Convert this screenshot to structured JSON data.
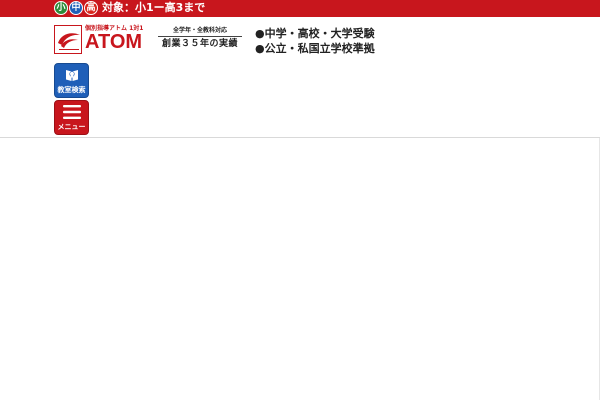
{
  "topbar": {
    "badges": [
      {
        "label": "小",
        "color": "#2e8b3a"
      },
      {
        "label": "中",
        "color": "#1f5fb8"
      },
      {
        "label": "高",
        "color": "#d9261c"
      }
    ],
    "target_text": "対象：小1ー高3まで",
    "background": "#c8161d"
  },
  "logo": {
    "tagline": "個別指導アトム 1対1",
    "name": "ATOM",
    "mark_icon": "red-swoosh-logo-icon",
    "brand_color": "#c8161d"
  },
  "slogan": {
    "small": "全学年・全教科対応",
    "main": "創業３５年の実績"
  },
  "features": [
    "●中学・高校・大学受験",
    "●公立・私国立学校準拠"
  ],
  "nav": {
    "search_label": "教室検索",
    "search_icon": "book-pin-icon",
    "search_color": "#1f5fb8",
    "menu_label": "メニュー",
    "menu_icon": "hamburger-icon",
    "menu_color": "#c8161d"
  }
}
